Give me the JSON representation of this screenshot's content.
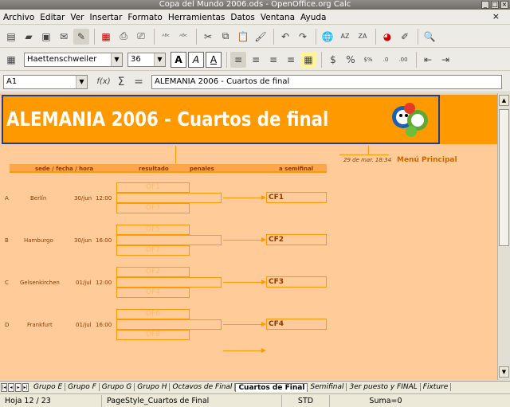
{
  "window": {
    "title": "Copa del Mundo 2006.ods - OpenOffice.org Calc"
  },
  "menu": [
    "Archivo",
    "Editar",
    "Ver",
    "Insertar",
    "Formato",
    "Herramientas",
    "Datos",
    "Ventana",
    "Ayuda"
  ],
  "toolbar": {
    "font_name": "Haettenschweiler",
    "font_size": "36"
  },
  "formula": {
    "cell_ref": "A1",
    "content": "ALEMANIA 2006 - Cuartos de final"
  },
  "sheet": {
    "banner_title": "ALEMANIA 2006 - Cuartos de final",
    "timestamp": "29 de mar. 18:34",
    "menu_link": "Menú Principal",
    "headers": {
      "sede": "sede / fecha / hora",
      "resultado": "resultado",
      "penales": "penales",
      "semifinal": "a semifinal"
    },
    "matches": [
      {
        "id": "A",
        "city": "Berlín",
        "date": "30/jun",
        "time": "12:00",
        "top": "OF1",
        "bottom": "OF3",
        "target": "CF1"
      },
      {
        "id": "B",
        "city": "Hamburgo",
        "date": "30/jun",
        "time": "16:00",
        "top": "OF5",
        "bottom": "OF7",
        "target": "CF2"
      },
      {
        "id": "C",
        "city": "Gelsenkirchen",
        "date": "01/jul",
        "time": "12:00",
        "top": "OF2",
        "bottom": "OF4",
        "target": "CF3"
      },
      {
        "id": "D",
        "city": "Frankfurt",
        "date": "01/jul",
        "time": "16:00",
        "top": "OF6",
        "bottom": "OF8",
        "target": "CF4"
      }
    ]
  },
  "tabs": [
    "Grupo E",
    "Grupo F",
    "Grupo G",
    "Grupo H",
    "Octavos de Final",
    "Cuartos de Final",
    "Semifinal",
    "3er puesto y FINAL",
    "Fixture"
  ],
  "active_tab": "Cuartos de Final",
  "status": {
    "sheet": "Hoja 12 / 23",
    "page_style": "PageStyle_Cuartos de Final",
    "mode": "STD",
    "sum": "Suma=0"
  }
}
